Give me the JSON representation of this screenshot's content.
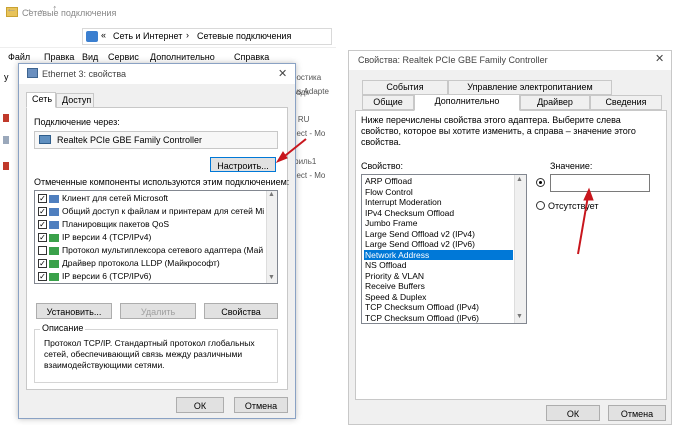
{
  "explorer": {
    "title": "Сетевые подключения",
    "breadcrumb": {
      "prefix": "«",
      "parent": "Сеть и Интернет",
      "separator": "›",
      "current": "Сетевые подключения"
    },
    "menu": [
      "Файл",
      "Правка",
      "Вид",
      "Сервис",
      "Дополнительно",
      "Справка"
    ],
    "right_texts": [
      "ростика подк",
      "ws Adapte",
      "",
      "т RU",
      "nect - Mo",
      "",
      "филь1",
      "nect - Mo",
      ""
    ],
    "left_letter": "у"
  },
  "ethernet_dialog": {
    "title": "Ethernet 3: свойства",
    "close_glyph": "✕",
    "tabs": [
      "Сеть",
      "Доступ"
    ],
    "connect_via_label": "Подключение через:",
    "adapter_name": "Realtek PCIe GBE Family Controller",
    "configure_button": "Настроить...",
    "components_label": "Отмеченные компоненты используются этим подключением:",
    "components": [
      {
        "checked": true,
        "icon": "client-icon",
        "label": "Клиент для сетей Microsoft"
      },
      {
        "checked": true,
        "icon": "share-icon",
        "label": "Общий доступ к файлам и принтерам для сетей Mi"
      },
      {
        "checked": true,
        "icon": "qos-icon",
        "label": "Планировщик пакетов QoS"
      },
      {
        "checked": true,
        "icon": "protocol-icon",
        "label": "IP версии 4 (TCP/IPv4)"
      },
      {
        "checked": false,
        "icon": "protocol-icon",
        "label": "Протокол мультиплексора сетевого адаптера (Май"
      },
      {
        "checked": true,
        "icon": "protocol-icon",
        "label": "Драйвер протокола LLDP (Майкрософт)"
      },
      {
        "checked": true,
        "icon": "protocol-icon",
        "label": "IP версии 6 (TCP/IPv6)"
      }
    ],
    "install_button": "Установить...",
    "remove_button": "Удалить",
    "properties_button": "Свойства",
    "description_legend": "Описание",
    "description_text": "Протокол TCP/IP. Стандартный протокол глобальных сетей, обеспечивающий связь между различными взаимодействующими сетями.",
    "ok_button": "ОК",
    "cancel_button": "Отмена"
  },
  "realtek_dialog": {
    "title": "Свойства: Realtek PCIe GBE Family Controller",
    "close_glyph": "✕",
    "tabs_top": [
      "События",
      "Управление электропитанием"
    ],
    "tabs_bottom": [
      "Общие",
      "Дополнительно",
      "Драйвер",
      "Сведения"
    ],
    "description": "Ниже перечислены свойства этого адаптера. Выберите слева свойство, которое вы хотите изменить, а справа – значение этого свойства.",
    "property_label": "Свойство:",
    "value_label": "Значение:",
    "properties": [
      "ARP Offload",
      "Flow Control",
      "Interrupt Moderation",
      "IPv4 Checksum Offload",
      "Jumbo Frame",
      "Large Send Offload v2 (IPv4)",
      "Large Send Offload v2 (IPv6)",
      "Network Address",
      "NS Offload",
      "Priority & VLAN",
      "Receive Buffers",
      "Speed & Duplex",
      "TCP Checksum Offload (IPv4)",
      "TCP Checksum Offload (IPv6)"
    ],
    "selected_property": "Network Address",
    "value_input": "",
    "absent_label": "Отсутствует",
    "ok_button": "ОК",
    "cancel_button": "Отмена"
  },
  "colors": {
    "selection": "#0078d7",
    "arrow": "#c8161d"
  }
}
